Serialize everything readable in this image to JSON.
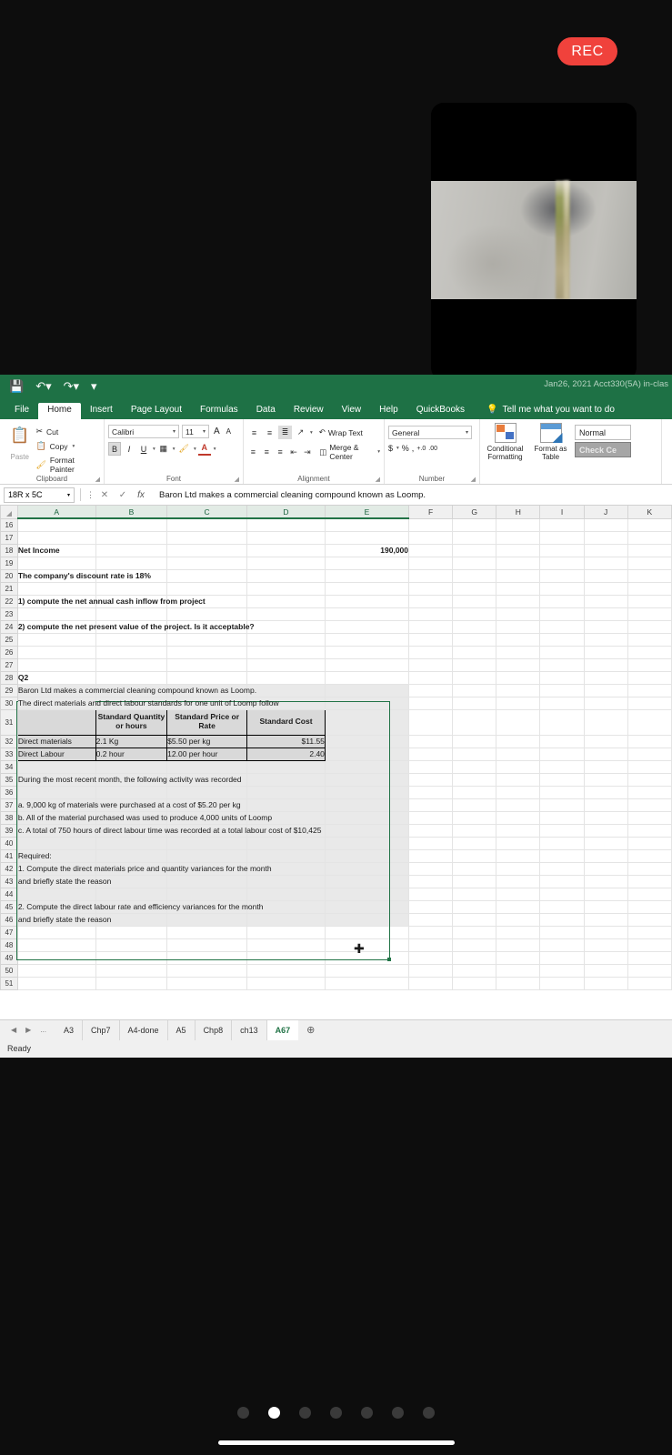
{
  "recording": {
    "badge_label": "REC"
  },
  "titlebar": {
    "document_title": "Jan26, 2021 Acct330(5A) in-clas",
    "save_icon": "save-icon",
    "undo_icon": "undo-icon",
    "redo_icon": "redo-icon",
    "customize_icon": "customize-quick-access-icon"
  },
  "ribbon": {
    "tabs": [
      {
        "label": "File"
      },
      {
        "label": "Home"
      },
      {
        "label": "Insert"
      },
      {
        "label": "Page Layout"
      },
      {
        "label": "Formulas"
      },
      {
        "label": "Data"
      },
      {
        "label": "Review"
      },
      {
        "label": "View"
      },
      {
        "label": "Help"
      },
      {
        "label": "QuickBooks"
      }
    ],
    "active_tab": "Home",
    "tell_me": "Tell me what you want to do",
    "groups": {
      "clipboard": {
        "label": "Clipboard",
        "paste": "Paste",
        "cut": "Cut",
        "copy": "Copy",
        "format_painter": "Format Painter"
      },
      "font": {
        "label": "Font",
        "font_name": "Calibri",
        "font_size": "11",
        "grow_font": "A",
        "shrink_font": "A",
        "bold": "B",
        "italic": "I",
        "underline": "U"
      },
      "alignment": {
        "label": "Alignment",
        "wrap_text": "Wrap Text",
        "merge_center": "Merge & Center"
      },
      "number": {
        "label": "Number",
        "format": "General",
        "currency": "$",
        "percent": "%",
        "comma": ",",
        "increase_decimal": "+.0",
        "decrease_decimal": ".00"
      },
      "styles": {
        "conditional_formatting": "Conditional Formatting",
        "format_as_table": "Format as Table",
        "style_normal": "Normal",
        "style_check_cell": "Check Ce"
      }
    }
  },
  "formula_bar": {
    "name_box": "18R x 5C",
    "cancel_icon": "cancel-icon",
    "enter_icon": "enter-icon",
    "function_icon": "insert-function-icon",
    "formula_value": "Baron Ltd makes a commercial cleaning compound known as Loomp."
  },
  "grid": {
    "columns": [
      "A",
      "B",
      "C",
      "D",
      "E",
      "F",
      "G",
      "H",
      "I",
      "J",
      "K"
    ],
    "selected_columns": [
      "A",
      "B",
      "C",
      "D",
      "E"
    ],
    "rows": [
      {
        "n": "16",
        "cells": []
      },
      {
        "n": "17",
        "cells": []
      },
      {
        "n": "18",
        "cells": [
          {
            "col": "A",
            "text": "Net Income",
            "bold": true
          },
          {
            "col": "E",
            "text": "190,000",
            "bold": true,
            "align": "right"
          }
        ]
      },
      {
        "n": "19",
        "cells": []
      },
      {
        "n": "20",
        "cells": [
          {
            "col": "A",
            "text": "The company's discount rate is 18%",
            "bold": true,
            "overflow": true
          }
        ]
      },
      {
        "n": "21",
        "cells": []
      },
      {
        "n": "22",
        "cells": [
          {
            "col": "A",
            "text": "1) compute the net annual cash inflow from project",
            "bold": true,
            "overflow": true
          }
        ]
      },
      {
        "n": "23",
        "cells": []
      },
      {
        "n": "24",
        "cells": [
          {
            "col": "A",
            "text": "2) compute the net present value of the project. Is it acceptable?",
            "bold": true,
            "overflow": true
          }
        ]
      },
      {
        "n": "25",
        "cells": []
      },
      {
        "n": "26",
        "cells": []
      },
      {
        "n": "27",
        "cells": []
      },
      {
        "n": "28",
        "cells": [
          {
            "col": "A",
            "text": "Q2",
            "bold": true
          }
        ]
      },
      {
        "n": "29",
        "cells": [
          {
            "col": "A",
            "text": "Baron Ltd makes a commercial cleaning compound known as Loomp.",
            "overflow": true,
            "selected": true
          }
        ]
      },
      {
        "n": "30",
        "cells": [
          {
            "col": "A",
            "text": "The direct materials and direct labour standards for one unit of Loomp follow",
            "overflow": true,
            "selected": true
          }
        ]
      },
      {
        "n": "31",
        "cells": [
          {
            "col": "A",
            "text": "",
            "table_header": true
          },
          {
            "col": "B",
            "text": "Standard Quantity or hours",
            "table_header": true
          },
          {
            "col": "C",
            "text": "Standard Price or Rate",
            "table_header": true
          },
          {
            "col": "D",
            "text": "Standard Cost",
            "table_header": true
          }
        ]
      },
      {
        "n": "32",
        "cells": [
          {
            "col": "A",
            "text": "Direct materials",
            "table_data": true
          },
          {
            "col": "B",
            "text": "2.1 Kg",
            "table_data": true
          },
          {
            "col": "C",
            "text": "$5.50 per kg",
            "table_data": true
          },
          {
            "col": "D",
            "text": "$11.55",
            "table_data": true,
            "align": "right"
          }
        ]
      },
      {
        "n": "33",
        "cells": [
          {
            "col": "A",
            "text": "Direct Labour",
            "table_data": true
          },
          {
            "col": "B",
            "text": "0.2 hour",
            "table_data": true
          },
          {
            "col": "C",
            "text": "12.00 per hour",
            "table_data": true
          },
          {
            "col": "D",
            "text": "2.40",
            "table_data": true,
            "align": "right"
          }
        ]
      },
      {
        "n": "34",
        "cells": []
      },
      {
        "n": "35",
        "cells": [
          {
            "col": "A",
            "text": "During the most recent month, the following activity was recorded",
            "overflow": true,
            "selected": true
          }
        ]
      },
      {
        "n": "36",
        "cells": []
      },
      {
        "n": "37",
        "cells": [
          {
            "col": "A",
            "text": "a. 9,000 kg of materials were purchased at a cost of $5.20 per kg",
            "overflow": true,
            "selected": true
          }
        ]
      },
      {
        "n": "38",
        "cells": [
          {
            "col": "A",
            "text": "b. All of the material purchased was used to produce 4,000 units of Loomp",
            "overflow": true,
            "selected": true
          }
        ]
      },
      {
        "n": "39",
        "cells": [
          {
            "col": "A",
            "text": "c. A total of 750 hours of direct labour time was recorded at a total labour cost of $10,425",
            "overflow": true,
            "selected": true
          }
        ]
      },
      {
        "n": "40",
        "cells": []
      },
      {
        "n": "41",
        "cells": [
          {
            "col": "A",
            "text": "Required:",
            "overflow": true,
            "selected": true
          }
        ]
      },
      {
        "n": "42",
        "cells": [
          {
            "col": "A",
            "text": "1. Compute the direct materials price and quantity variances for the month",
            "overflow": true,
            "selected": true
          }
        ]
      },
      {
        "n": "43",
        "cells": [
          {
            "col": "A",
            "text": "and briefly state the reason",
            "overflow": true,
            "selected": true
          }
        ]
      },
      {
        "n": "44",
        "cells": []
      },
      {
        "n": "45",
        "cells": [
          {
            "col": "A",
            "text": "2. Compute the direct labour rate and efficiency variances for the month",
            "overflow": true,
            "selected": true
          }
        ]
      },
      {
        "n": "46",
        "cells": [
          {
            "col": "A",
            "text": "and briefly state the reason",
            "overflow": true,
            "selected": true
          }
        ]
      },
      {
        "n": "47",
        "cells": []
      },
      {
        "n": "48",
        "cells": []
      },
      {
        "n": "49",
        "cells": []
      },
      {
        "n": "50",
        "cells": []
      },
      {
        "n": "51",
        "cells": []
      }
    ]
  },
  "sheet_bar": {
    "first_arrow": "◀",
    "last_arrow": "▶",
    "more": "...",
    "tabs": [
      {
        "label": "A3"
      },
      {
        "label": "Chp7"
      },
      {
        "label": "A4-done"
      },
      {
        "label": "A5"
      },
      {
        "label": "Chp8"
      },
      {
        "label": "ch13"
      },
      {
        "label": "A67"
      }
    ],
    "active_tab": "A67",
    "add_sheet_icon": "add-sheet-icon"
  },
  "status_bar": {
    "text": "Ready"
  },
  "phone": {
    "page_dots": 7,
    "active_dot_index": 1
  },
  "colors": {
    "excel_green": "#1e7145",
    "accent_green": "#217346",
    "rec_red": "#f0423c"
  }
}
